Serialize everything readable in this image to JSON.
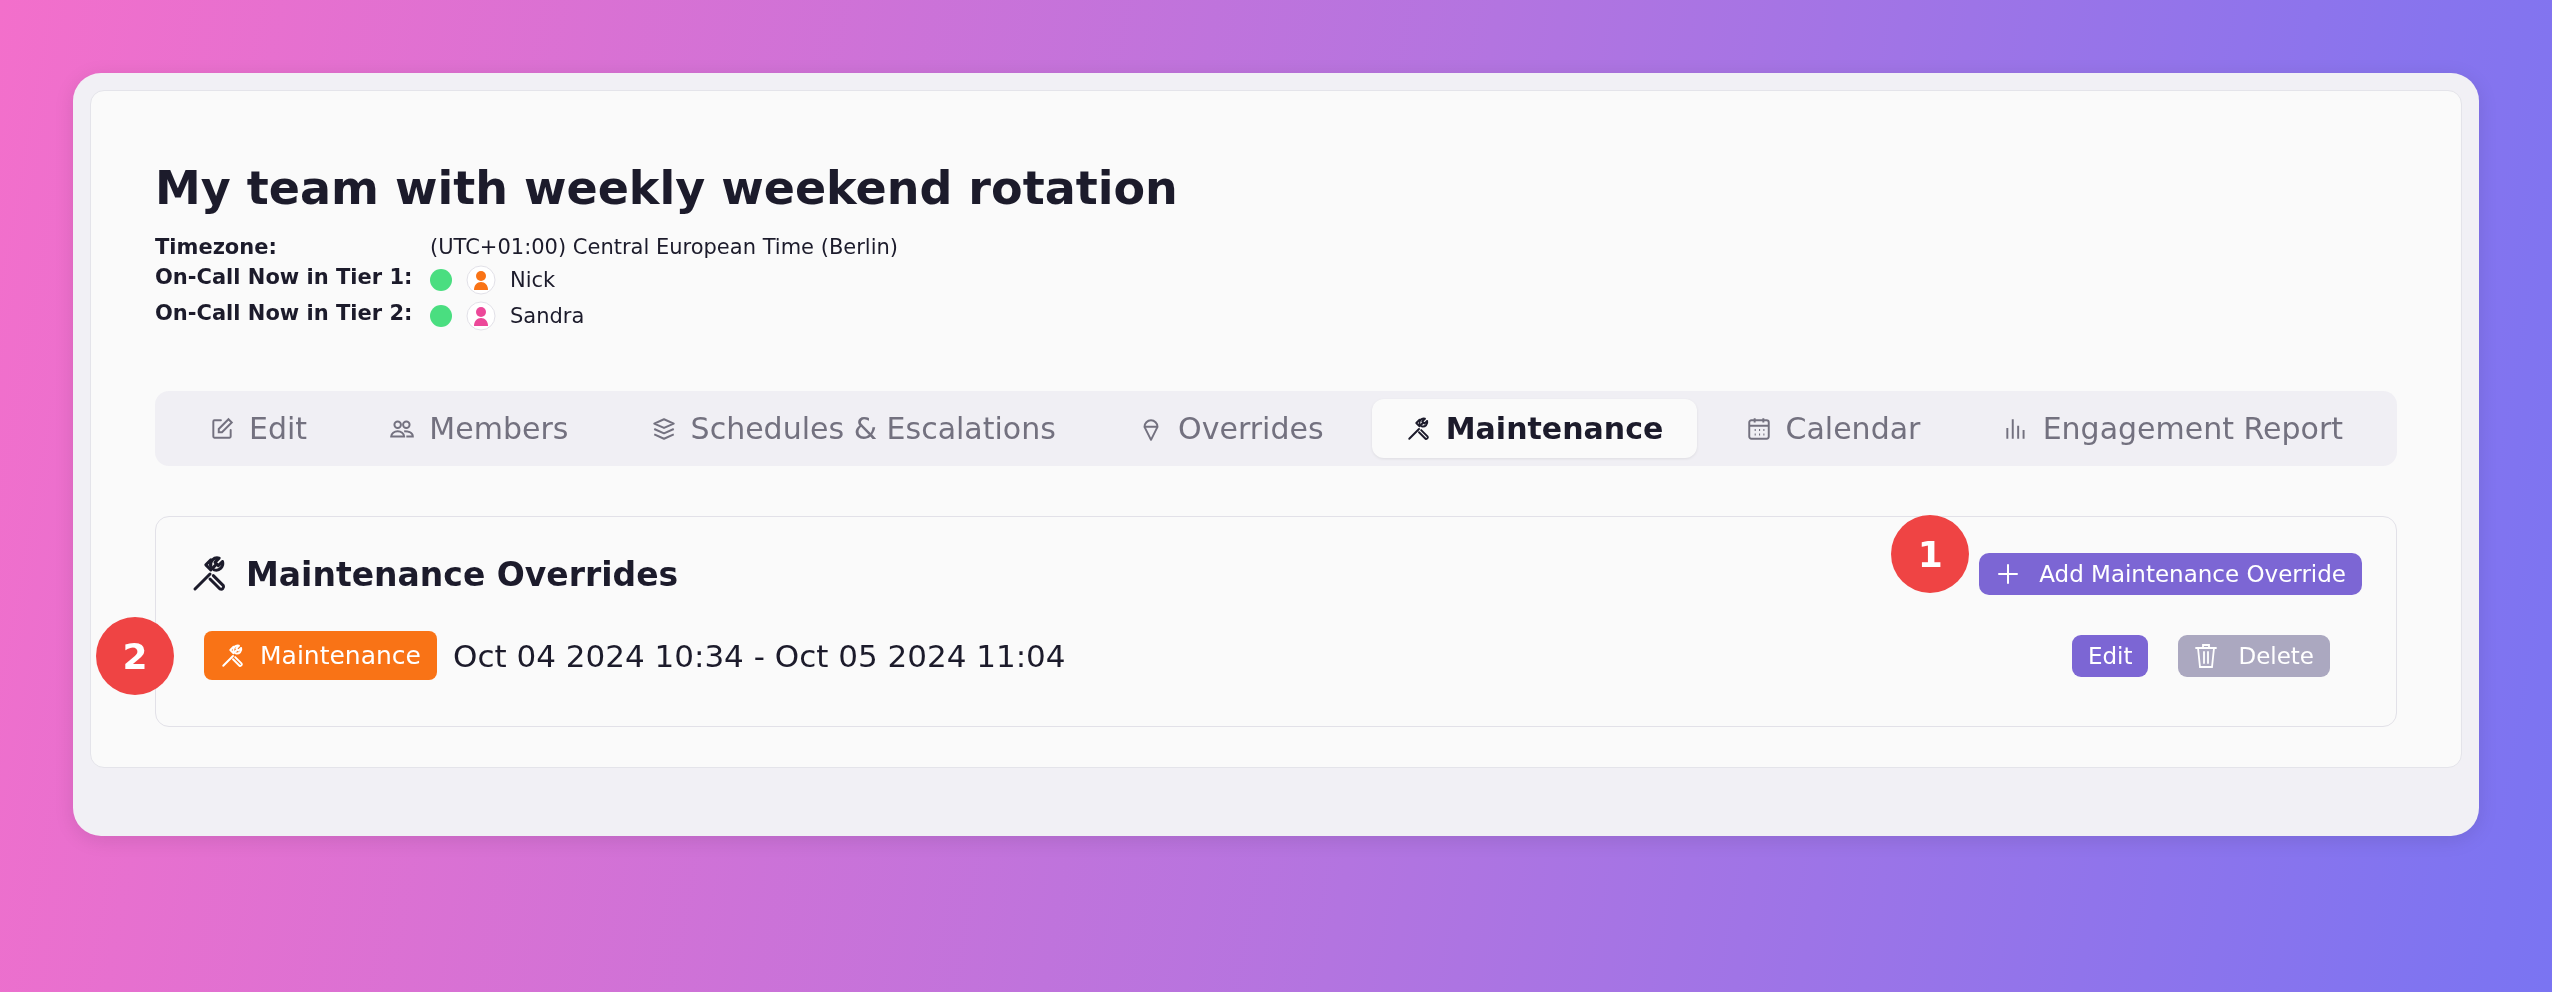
{
  "title": "My team with weekly weekend rotation",
  "info": [
    {
      "kind": "text",
      "label": "Timezone:",
      "value": "(UTC+01:00) Central European Time (Berlin)"
    },
    {
      "kind": "person",
      "label": "On-Call Now in Tier 1:",
      "on_call": true,
      "person": "Nick"
    },
    {
      "kind": "person",
      "label": "On-Call Now in Tier 2:",
      "on_call": true,
      "person": "Sandra"
    }
  ],
  "tabs": [
    {
      "label": "Edit",
      "selected": false
    },
    {
      "label": "Members",
      "selected": false
    },
    {
      "label": "Schedules & Escalations",
      "selected": false
    },
    {
      "label": "Overrides",
      "selected": false
    },
    {
      "label": "Maintenance",
      "selected": true
    },
    {
      "label": "Calendar",
      "selected": false
    },
    {
      "label": "Engagement Report",
      "selected": false
    }
  ],
  "section": {
    "title": "Maintenance Overrides",
    "add_button": "Add Maintenance Override",
    "entries": [
      {
        "tag": "Maintenance",
        "period": "Oct 04 2024 10:34 - Oct 05 2024 11:04",
        "actions": [
          {
            "kind": "edit",
            "label": "Edit",
            "disabled": false
          },
          {
            "kind": "delete",
            "label": "Delete",
            "disabled": true
          }
        ]
      }
    ]
  },
  "callouts": [
    "1",
    "2"
  ]
}
